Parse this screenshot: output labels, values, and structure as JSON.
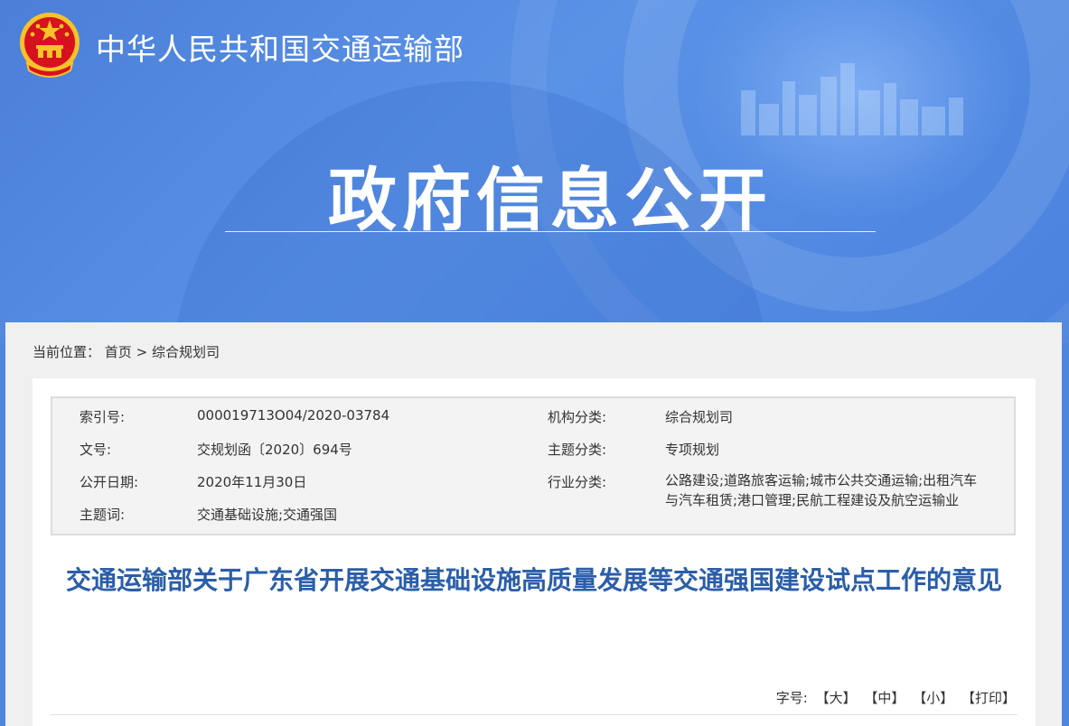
{
  "header": {
    "ministry_name": "中华人民共和国交通运输部",
    "banner_title": "政府信息公开",
    "colors": {
      "banner": "#4f86dd",
      "title_blue": "#2b5ea8",
      "emblem_red": "#d6121f",
      "emblem_gold": "#f7c22a"
    }
  },
  "breadcrumb": {
    "prefix": "当前位置：",
    "home": "首页",
    "separator": ">",
    "current": "综合规划司"
  },
  "meta": {
    "index_label": "索引号:",
    "index_value": "000019713O04/2020-03784",
    "doc_no_label": "文号:",
    "doc_no_value": "交规划函〔2020〕694号",
    "pub_date_label": "公开日期:",
    "pub_date_value": "2020年11月30日",
    "keywords_label": "主题词:",
    "keywords_value": "交通基础设施;交通强国",
    "org_label": "机构分类:",
    "org_value": "综合规划司",
    "topic_label": "主题分类:",
    "topic_value": "专项规划",
    "industry_label": "行业分类:",
    "industry_value": "公路建设;道路旅客运输;城市公共交通运输;出租汽车与汽车租赁;港口管理;民航工程建设及航空运输业"
  },
  "document": {
    "title": "交通运输部关于广东省开展交通基础设施高质量发展等交通强国建设试点工作的意见"
  },
  "font_size": {
    "label": "字号:",
    "large": "【大】",
    "medium": "【中】",
    "small": "【小】",
    "print": "【打印】"
  }
}
